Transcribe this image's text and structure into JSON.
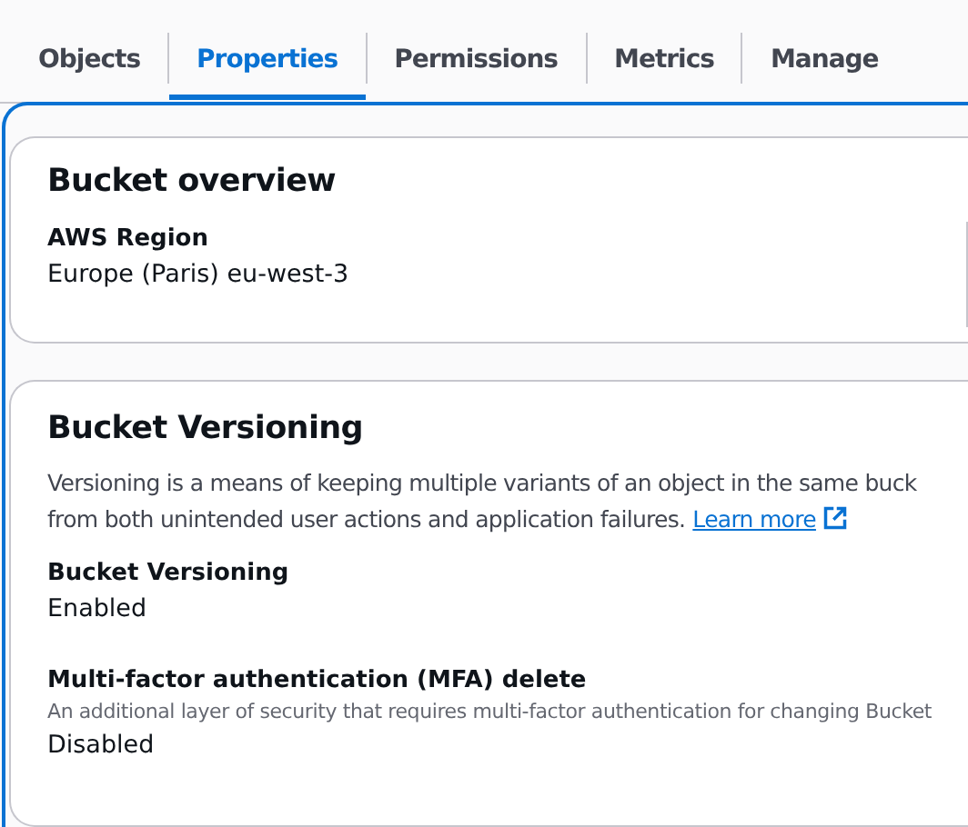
{
  "tabs": [
    {
      "label": "Objects",
      "selected": false
    },
    {
      "label": "Properties",
      "selected": true
    },
    {
      "label": "Permissions",
      "selected": false
    },
    {
      "label": "Metrics",
      "selected": false
    },
    {
      "label": "Manage",
      "selected": false
    }
  ],
  "overview": {
    "title": "Bucket overview",
    "fields": [
      {
        "label": "AWS Region",
        "value": "Europe (Paris) eu-west-3"
      }
    ]
  },
  "versioning": {
    "title": "Bucket Versioning",
    "description": "Versioning is a means of keeping multiple variants of an object in the same buck",
    "description_line_2": "from both unintended user actions and application failures.",
    "link": "Learn more",
    "fields": [
      {
        "label": "Bucket Versioning",
        "value": "Enabled"
      },
      {
        "label": "Multi-factor authentication (MFA) delete",
        "hint": "An additional layer of security that requires multi-factor authentication for changing Bucket",
        "value": "Disabled"
      }
    ]
  }
}
